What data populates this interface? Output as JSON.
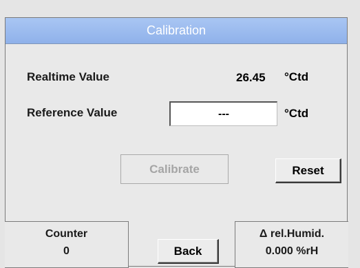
{
  "window": {
    "title": "Calibration"
  },
  "realtime": {
    "label": "Realtime Value",
    "value": "26.45",
    "unit": "°Ctd"
  },
  "reference": {
    "label": "Reference Value",
    "value": "---",
    "unit": "°Ctd"
  },
  "buttons": {
    "calibrate": "Calibrate",
    "reset": "Reset",
    "back": "Back"
  },
  "counter": {
    "label": "Counter",
    "value": "0"
  },
  "humidity": {
    "label": "Δ rel.Humid.",
    "value": "0.000 %rH"
  },
  "colors": {
    "titlebar": "#9bb9ee",
    "background": "#e9e9e9",
    "disabled_text": "#a5a5a5"
  }
}
